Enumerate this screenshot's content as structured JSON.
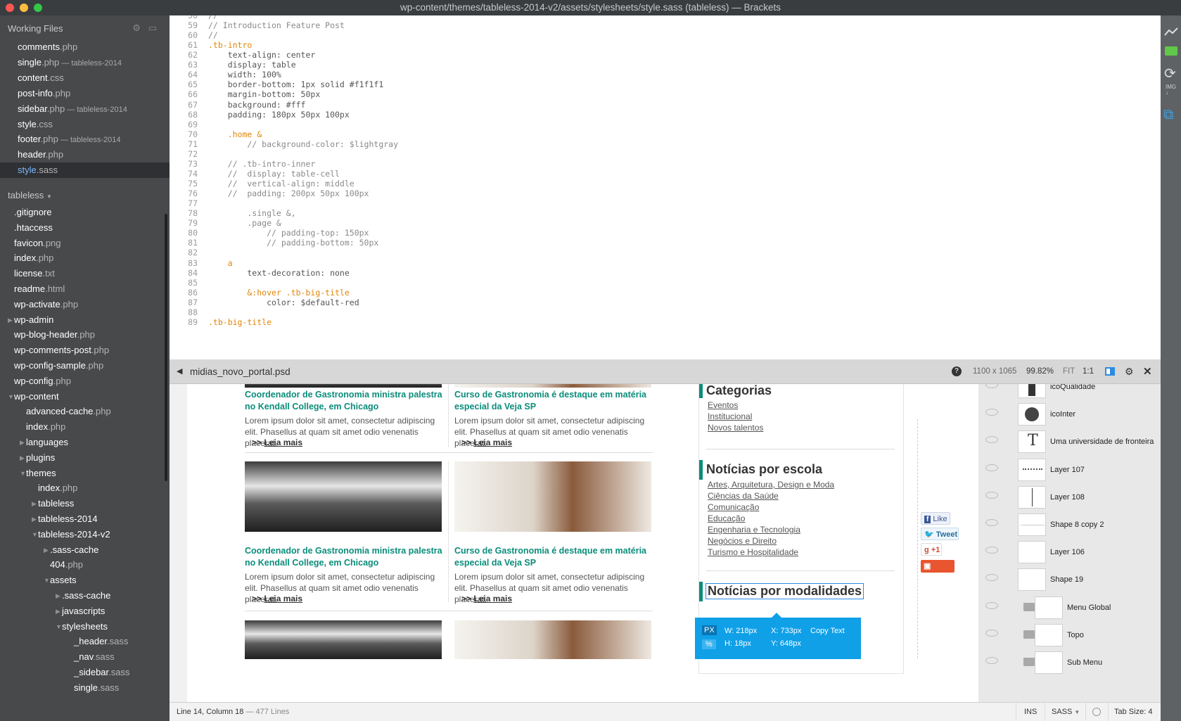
{
  "window": {
    "title": "wp-content/themes/tableless-2014-v2/assets/stylesheets/style.sass (tableless) — Brackets"
  },
  "sidebar": {
    "working_files_title": "Working Files",
    "working_files": [
      {
        "name": "comments",
        "ext": ".php",
        "suffix": ""
      },
      {
        "name": "single",
        "ext": ".php",
        "suffix": " — tableless-2014"
      },
      {
        "name": "content",
        "ext": ".css",
        "suffix": ""
      },
      {
        "name": "post-info",
        "ext": ".php",
        "suffix": ""
      },
      {
        "name": "sidebar",
        "ext": ".php",
        "suffix": " — tableless-2014"
      },
      {
        "name": "style",
        "ext": ".css",
        "suffix": ""
      },
      {
        "name": "footer",
        "ext": ".php",
        "suffix": " — tableless-2014"
      },
      {
        "name": "header",
        "ext": ".php",
        "suffix": ""
      },
      {
        "name": "style",
        "ext": ".sass",
        "suffix": "",
        "selected": true
      }
    ],
    "project_title": "tableless",
    "tree": [
      {
        "name": ".gitignore",
        "ext": "",
        "depth": 0,
        "arrow": ""
      },
      {
        "name": ".htaccess",
        "ext": "",
        "depth": 0,
        "arrow": ""
      },
      {
        "name": "favicon",
        "ext": ".png",
        "depth": 0,
        "arrow": ""
      },
      {
        "name": "index",
        "ext": ".php",
        "depth": 0,
        "arrow": ""
      },
      {
        "name": "license",
        "ext": ".txt",
        "depth": 0,
        "arrow": ""
      },
      {
        "name": "readme",
        "ext": ".html",
        "depth": 0,
        "arrow": ""
      },
      {
        "name": "wp-activate",
        "ext": ".php",
        "depth": 0,
        "arrow": ""
      },
      {
        "name": "wp-admin",
        "ext": "",
        "depth": 0,
        "arrow": "▶"
      },
      {
        "name": "wp-blog-header",
        "ext": ".php",
        "depth": 0,
        "arrow": ""
      },
      {
        "name": "wp-comments-post",
        "ext": ".php",
        "depth": 0,
        "arrow": ""
      },
      {
        "name": "wp-config-sample",
        "ext": ".php",
        "depth": 0,
        "arrow": ""
      },
      {
        "name": "wp-config",
        "ext": ".php",
        "depth": 0,
        "arrow": ""
      },
      {
        "name": "wp-content",
        "ext": "",
        "depth": 0,
        "arrow": "▼"
      },
      {
        "name": "advanced-cache",
        "ext": ".php",
        "depth": 1,
        "arrow": ""
      },
      {
        "name": "index",
        "ext": ".php",
        "depth": 1,
        "arrow": ""
      },
      {
        "name": "languages",
        "ext": "",
        "depth": 1,
        "arrow": "▶"
      },
      {
        "name": "plugins",
        "ext": "",
        "depth": 1,
        "arrow": "▶"
      },
      {
        "name": "themes",
        "ext": "",
        "depth": 1,
        "arrow": "▼"
      },
      {
        "name": "index",
        "ext": ".php",
        "depth": 2,
        "arrow": ""
      },
      {
        "name": "tableless",
        "ext": "",
        "depth": 2,
        "arrow": "▶"
      },
      {
        "name": "tableless-2014",
        "ext": "",
        "depth": 2,
        "arrow": "▶"
      },
      {
        "name": "tableless-2014-v2",
        "ext": "",
        "depth": 2,
        "arrow": "▼"
      },
      {
        "name": ".sass-cache",
        "ext": "",
        "depth": 3,
        "arrow": "▶"
      },
      {
        "name": "404",
        "ext": ".php",
        "depth": 3,
        "arrow": ""
      },
      {
        "name": "assets",
        "ext": "",
        "depth": 3,
        "arrow": "▼"
      },
      {
        "name": ".sass-cache",
        "ext": "",
        "depth": 4,
        "arrow": "▶"
      },
      {
        "name": "javascripts",
        "ext": "",
        "depth": 4,
        "arrow": "▶"
      },
      {
        "name": "stylesheets",
        "ext": "",
        "depth": 4,
        "arrow": "▼"
      },
      {
        "name": "_header",
        "ext": ".sass",
        "depth": 5,
        "arrow": ""
      },
      {
        "name": "_nav",
        "ext": ".sass",
        "depth": 5,
        "arrow": ""
      },
      {
        "name": "_sidebar",
        "ext": ".sass",
        "depth": 5,
        "arrow": ""
      },
      {
        "name": "single",
        "ext": ".sass",
        "depth": 5,
        "arrow": ""
      }
    ]
  },
  "editor": {
    "lines": [
      {
        "n": "58",
        "t": "//",
        "c": "#8a8a8a"
      },
      {
        "n": "59",
        "t": "// Introduction Feature Post",
        "c": "#8a8a8a"
      },
      {
        "n": "60",
        "t": "//",
        "c": "#8a8a8a"
      },
      {
        "n": "61",
        "t": ".tb-intro",
        "c": "#e0860a"
      },
      {
        "n": "62",
        "t": "    text-align: center",
        "c": "#555"
      },
      {
        "n": "63",
        "t": "    display: table",
        "c": "#555"
      },
      {
        "n": "64",
        "t": "    width: 100%",
        "c": "#555"
      },
      {
        "n": "65",
        "t": "    border-bottom: 1px solid #f1f1f1",
        "c": "#555"
      },
      {
        "n": "66",
        "t": "    margin-bottom: 50px",
        "c": "#555"
      },
      {
        "n": "67",
        "t": "    background: #fff",
        "c": "#555"
      },
      {
        "n": "68",
        "t": "    padding: 180px 50px 100px",
        "c": "#555"
      },
      {
        "n": "69",
        "t": "",
        "c": "#555"
      },
      {
        "n": "70",
        "t": "    .home &",
        "c": "#e0860a"
      },
      {
        "n": "71",
        "t": "        // background-color: $lightgray",
        "c": "#8a8a8a"
      },
      {
        "n": "72",
        "t": "",
        "c": "#555"
      },
      {
        "n": "73",
        "t": "    // .tb-intro-inner",
        "c": "#8a8a8a"
      },
      {
        "n": "74",
        "t": "    //  display: table-cell",
        "c": "#8a8a8a"
      },
      {
        "n": "75",
        "t": "    //  vertical-align: middle",
        "c": "#8a8a8a"
      },
      {
        "n": "76",
        "t": "    //  padding: 200px 50px 100px",
        "c": "#8a8a8a"
      },
      {
        "n": "77",
        "t": "",
        "c": "#555"
      },
      {
        "n": "78",
        "t": "        .single &,",
        "c": "#8a8a8a"
      },
      {
        "n": "79",
        "t": "        .page &",
        "c": "#8a8a8a"
      },
      {
        "n": "80",
        "t": "            // padding-top: 150px",
        "c": "#8a8a8a"
      },
      {
        "n": "81",
        "t": "            // padding-bottom: 50px",
        "c": "#8a8a8a"
      },
      {
        "n": "82",
        "t": "",
        "c": "#555"
      },
      {
        "n": "83",
        "t": "    a",
        "c": "#e0860a"
      },
      {
        "n": "84",
        "t": "        text-decoration: none",
        "c": "#555"
      },
      {
        "n": "85",
        "t": "",
        "c": "#555"
      },
      {
        "n": "86",
        "t": "        &:hover .tb-big-title",
        "c": "#e0860a"
      },
      {
        "n": "87",
        "t": "            color: $default-red",
        "c": "#555"
      },
      {
        "n": "88",
        "t": "",
        "c": "#555"
      },
      {
        "n": "89",
        "t": ".tb-big-title",
        "c": "#e0860a"
      }
    ]
  },
  "image_viewer": {
    "filename": "midias_novo_portal.psd",
    "dimensions": "1100 x 1065",
    "zoom": "99.82%",
    "fit": "FIT",
    "one_to_one": "1:1"
  },
  "preview": {
    "articles": [
      {
        "title": "Coordenador de Gastronomia ministra palestra no Kendall College, em Chicago",
        "body": "Lorem ipsum dolor sit amet, consectetur adipiscing elit. Phasellus at quam sit amet odio venenatis placerat.",
        "more_prefix": ">>",
        "more": "Leia mais"
      },
      {
        "title": "Curso de Gastronomia é destaque em matéria especial da Veja SP",
        "body": "Lorem ipsum dolor sit amet, consectetur adipiscing elit. Phasellus at quam sit amet odio venenatis placerat.",
        "more_prefix": ">>",
        "more": "Leia mais"
      },
      {
        "title": "Coordenador de Gastronomia ministra palestra no Kendall College, em Chicago",
        "body": "Lorem ipsum dolor sit amet, consectetur adipiscing elit. Phasellus at quam sit amet odio venenatis placerat.",
        "more_prefix": ">>",
        "more": "Leia mais"
      },
      {
        "title": "Curso de Gastronomia é destaque em matéria especial da Veja SP",
        "body": "Lorem ipsum dolor sit amet, consectetur adipiscing elit. Phasellus at quam sit amet odio venenatis placerat.",
        "more_prefix": ">>",
        "more": "Leia mais"
      }
    ],
    "categorias": {
      "title": "Categorias",
      "links": [
        "Eventos",
        "Institucional",
        "Novos talentos"
      ]
    },
    "escola": {
      "title": "Notícias por escola",
      "links": [
        "Artes, Arquitetura, Design e Moda",
        "Ciências da Saúde",
        "Comunicação",
        "Educação",
        "Engenharia e Tecnologia",
        "Negócios e Direito",
        "Turismo e Hospitalidade"
      ]
    },
    "modalidades": {
      "title": "Notícias por modalidades"
    },
    "social": {
      "like": "Like",
      "tweet": "Tweet",
      "plus": "+1",
      "share": "Share"
    }
  },
  "tooltip": {
    "px": "PX",
    "pct": "%",
    "w": "W: 218px",
    "h": "H: 18px",
    "x": "X: 733px",
    "y": "Y: 648px",
    "copy": "Copy Text"
  },
  "layers": [
    {
      "name": "icoQualidade",
      "thumb": "icon",
      "folder": false
    },
    {
      "name": "icoInter",
      "thumb": "globe",
      "folder": false
    },
    {
      "name": "Uma universidade de fronteira",
      "thumb": "text",
      "folder": false
    },
    {
      "name": "Layer 107",
      "thumb": "dots",
      "folder": false
    },
    {
      "name": "Layer 108",
      "thumb": "vline",
      "folder": false
    },
    {
      "name": "Shape 8 copy 2",
      "thumb": "hline",
      "folder": false
    },
    {
      "name": "Layer 106",
      "thumb": "blank",
      "folder": false
    },
    {
      "name": "Shape 19",
      "thumb": "blank",
      "folder": false
    },
    {
      "name": "Menu Global",
      "thumb": "blank",
      "folder": true
    },
    {
      "name": "Topo",
      "thumb": "blank",
      "folder": true
    },
    {
      "name": "Sub Menu",
      "thumb": "blank",
      "folder": true
    }
  ],
  "statusbar": {
    "position": "Line 14, Column 18",
    "lines": " — 477 Lines",
    "mode": "INS",
    "language": "SASS",
    "tabsize": "Tab Size:",
    "tabsize_val": "4"
  }
}
